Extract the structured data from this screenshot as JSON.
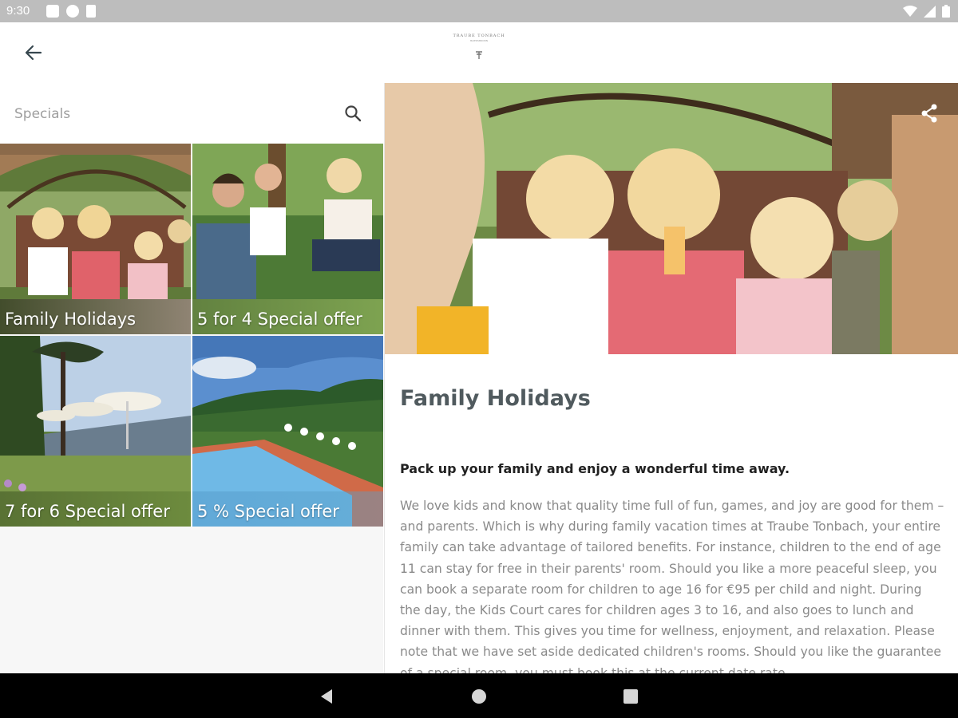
{
  "status_bar": {
    "time": "9:30"
  },
  "app_bar": {
    "logo_text": "TRAUBE TONBACH",
    "logo_subtext": "BAIERSBRONN"
  },
  "search": {
    "placeholder": "Specials"
  },
  "specials": [
    {
      "title": "Family Holidays"
    },
    {
      "title": "5 for 4 Special offer"
    },
    {
      "title": "7 for 6 Special offer"
    },
    {
      "title": "5 % Special offer"
    }
  ],
  "detail": {
    "title": "Family Holidays",
    "lead": "Pack up your family and enjoy a wonderful time away.",
    "body": "We love kids and know that quality time full of fun, games, and joy are good for them – and parents. Which is why during family vacation times at Traube Tonbach, your entire family can take advantage of tailored benefits. For instance, children to the end of age 11 can stay for free in their parents' room. Should you like a more peaceful sleep, you can book a separate room for children to age 16 for €95 per child and night. During the day, the Kids Court cares for children ages 3 to 16, and also goes to lunch and dinner with them. This gives you time for wellness, enjoyment, and relaxation. Please note that we have set aside dedicated children's rooms. Should you like the guarantee of a special room, you must book this at the current date rate."
  },
  "icons": {
    "back": "arrow-back-icon",
    "search": "search-icon",
    "share": "share-icon",
    "nav_back": "triangle-back-icon",
    "nav_home": "circle-home-icon",
    "nav_recents": "square-recents-icon"
  },
  "colors": {
    "status_bar": "#bdbdbd",
    "title_text": "#505a5e",
    "body_text": "#8a8a8a",
    "nav_bar": "#000000"
  }
}
